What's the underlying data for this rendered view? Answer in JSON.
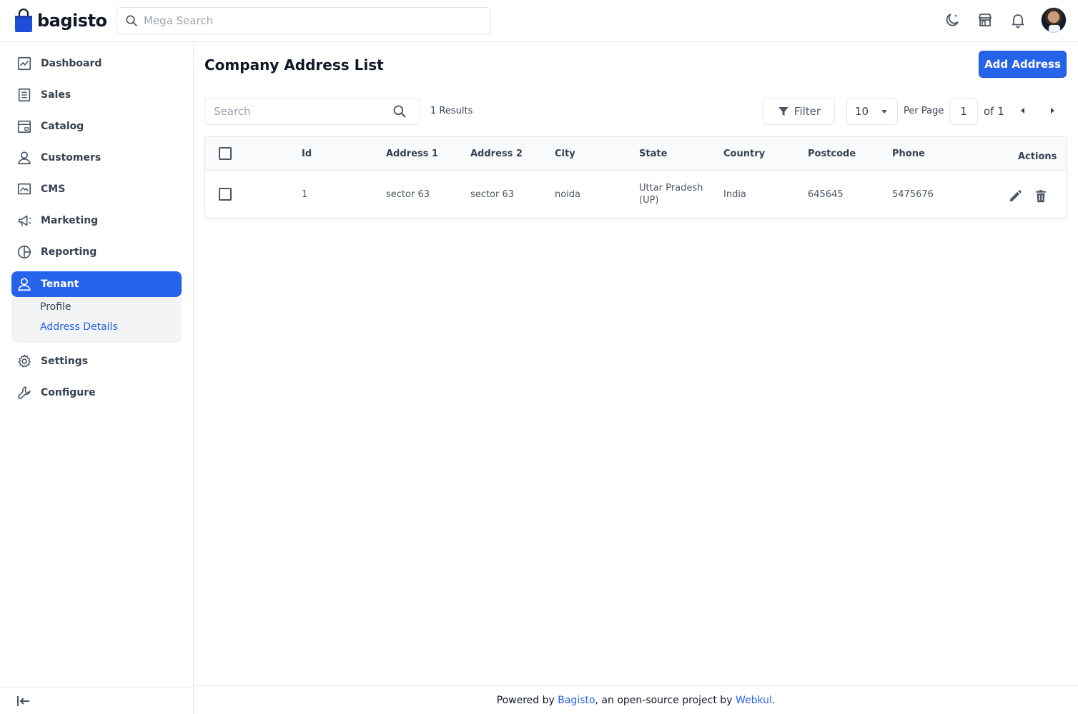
{
  "brand": {
    "name": "bagisto",
    "color": "#1d4ed8"
  },
  "header": {
    "search_placeholder": "Mega Search",
    "icons": [
      "moon-icon",
      "store-icon",
      "bell-icon",
      "avatar"
    ]
  },
  "sidebar": {
    "items": [
      {
        "label": "Dashboard",
        "icon": "dashboard-icon"
      },
      {
        "label": "Sales",
        "icon": "sales-icon"
      },
      {
        "label": "Catalog",
        "icon": "catalog-icon"
      },
      {
        "label": "Customers",
        "icon": "customers-icon"
      },
      {
        "label": "CMS",
        "icon": "cms-icon"
      },
      {
        "label": "Marketing",
        "icon": "marketing-icon"
      },
      {
        "label": "Reporting",
        "icon": "reporting-icon"
      },
      {
        "label": "Tenant",
        "icon": "tenant-icon",
        "active": true
      },
      {
        "label": "Settings",
        "icon": "settings-icon"
      },
      {
        "label": "Configure",
        "icon": "configure-icon"
      }
    ],
    "subitems": [
      {
        "label": "Profile"
      },
      {
        "label": "Address Details",
        "active": true
      }
    ]
  },
  "main": {
    "title": "Company Address List",
    "add_button": "Add Address",
    "search_placeholder": "Search",
    "results": "1 Results",
    "filter_label": "Filter",
    "per_page_value": "10",
    "per_page_label": "Per Page",
    "page_current": "1",
    "page_of": "of 1"
  },
  "table": {
    "columns": [
      "Id",
      "Address 1",
      "Address 2",
      "City",
      "State",
      "Country",
      "Postcode",
      "Phone",
      "Actions"
    ],
    "rows": [
      {
        "id": "1",
        "address1": "sector 63",
        "address2": "sector 63",
        "city": "noida",
        "state": "Uttar Pradesh (UP)",
        "country": "India",
        "postcode": "645645",
        "phone": "5475676"
      }
    ]
  },
  "footer": {
    "prefix": "Powered by ",
    "link1": "Bagisto",
    "middle": ", an open-source project by ",
    "link2": "Webkul",
    "suffix": "."
  },
  "colors": {
    "primary": "#2563eb",
    "border": "#e5e7eb",
    "text": "#374151"
  }
}
